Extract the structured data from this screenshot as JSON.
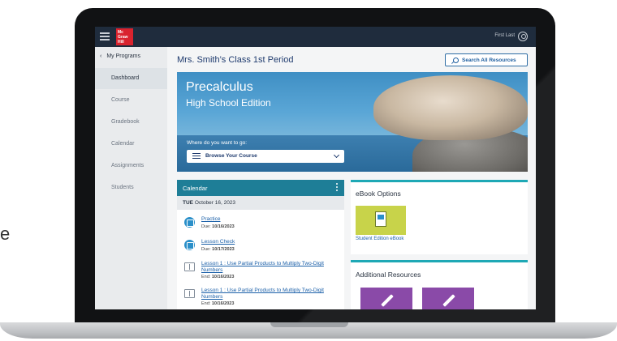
{
  "stray": "e",
  "topbar": {
    "logo_lines": [
      "Mc",
      "Graw",
      "Hill"
    ],
    "user_name": "First Last"
  },
  "sidebar": {
    "programs_label": "My Programs",
    "items": [
      {
        "label": "Dashboard",
        "active": true
      },
      {
        "label": "Course",
        "active": false
      },
      {
        "label": "Gradebook",
        "active": false
      },
      {
        "label": "Calendar",
        "active": false
      },
      {
        "label": "Assignments",
        "active": false
      },
      {
        "label": "Students",
        "active": false
      }
    ]
  },
  "main": {
    "class_title": "Mrs. Smith’s Class 1st Period",
    "search_label": "Search All Resources",
    "hero": {
      "title": "Precalculus",
      "subtitle": "High School Edition",
      "goto_label": "Where do you want to go:",
      "select_value": "Browse Your Course"
    },
    "calendar": {
      "title": "Calendar",
      "day": "TUE",
      "date": "October 16, 2023",
      "items": [
        {
          "title": "Practice",
          "due_label": "Due:",
          "due": "10/16/2023"
        },
        {
          "title": "Lesson Check",
          "due_label": "Due:",
          "due": "10/17/2023"
        },
        {
          "title": "Lesson 1 : Use Partial Products to Multiply Two-Digit Numbers",
          "due_label": "End:",
          "due": "10/16/2023"
        },
        {
          "title": "Lesson 1 : Use Partial Products to Multiply Two-Digit Numbers",
          "due_label": "End:",
          "due": "10/16/2023"
        }
      ]
    },
    "ebook": {
      "title": "eBook Options",
      "tile_label": "Student Edition eBook"
    },
    "resources": {
      "title": "Additional Resources"
    }
  },
  "colors": {
    "topbar": "#1f2c3d",
    "brand_red": "#d9232e",
    "calendar_header": "#1e7e97",
    "panel_accent": "#1ea8b5",
    "ebook_tile": "#c8d34a",
    "resource_tile": "#8a4aa8",
    "link": "#1a5fa8"
  }
}
